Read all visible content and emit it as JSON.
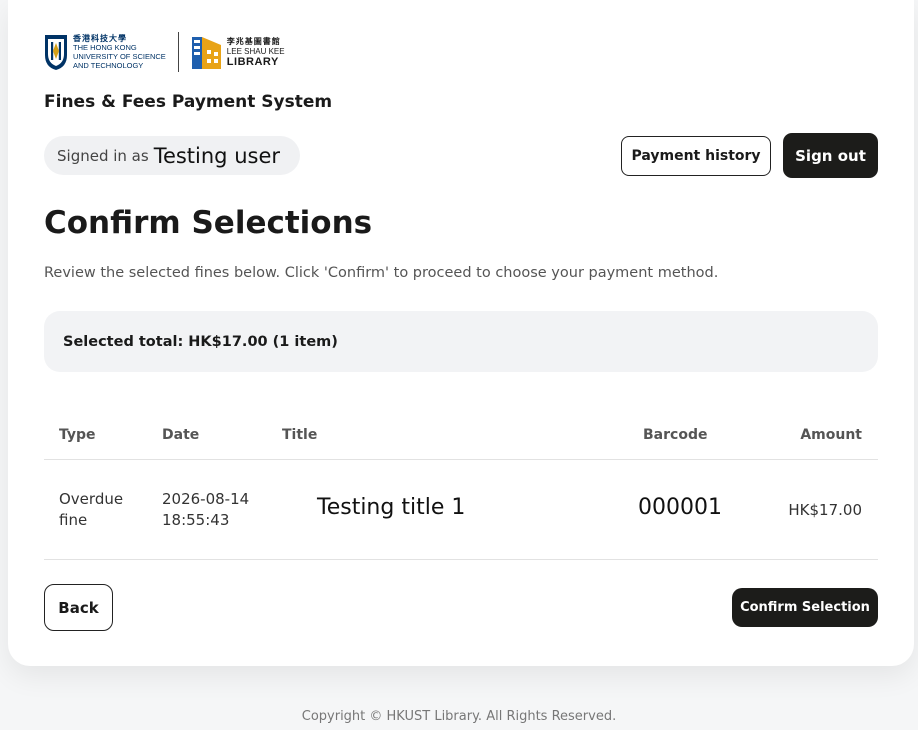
{
  "logos": {
    "hkust": {
      "name_zh": "香港科技大學",
      "name_en_lines": [
        "THE HONG KONG",
        "UNIVERSITY OF SCIENCE",
        "AND TECHNOLOGY"
      ]
    },
    "library": {
      "name_zh": "李兆基圖書館",
      "name_en": "LEE SHAU KEE",
      "library_word": "LIBRARY"
    }
  },
  "app_title": "Fines & Fees Payment System",
  "session": {
    "signed_in_prefix": "Signed in as",
    "user_name": "Testing user"
  },
  "header_buttons": {
    "payment_history": "Payment history",
    "sign_out": "Sign out"
  },
  "page": {
    "heading": "Confirm Selections",
    "description": "Review the selected fines below. Click 'Confirm' to proceed to choose your payment method."
  },
  "summary": {
    "selected_total": "Selected total: HK$17.00 (1 item)"
  },
  "table": {
    "columns": [
      "Type",
      "Date",
      "Title",
      "Barcode",
      "Amount"
    ],
    "rows": [
      {
        "type_lines": [
          "Overdue",
          "fine"
        ],
        "date_lines": [
          "2026-08-14",
          "18:55:43"
        ],
        "title": "Testing title 1",
        "barcode": "000001",
        "amount": "HK$17.00"
      }
    ]
  },
  "actions": {
    "back": "Back",
    "confirm": "Confirm Selection"
  },
  "footer": "Copyright © HKUST Library. All Rights Reserved.",
  "colors": {
    "primary_dark": "#1c1c1a",
    "hkust_blue": "#003366",
    "library_blue": "#1f5fae",
    "library_gold": "#e8a317",
    "panel_gray": "#f2f3f5"
  }
}
